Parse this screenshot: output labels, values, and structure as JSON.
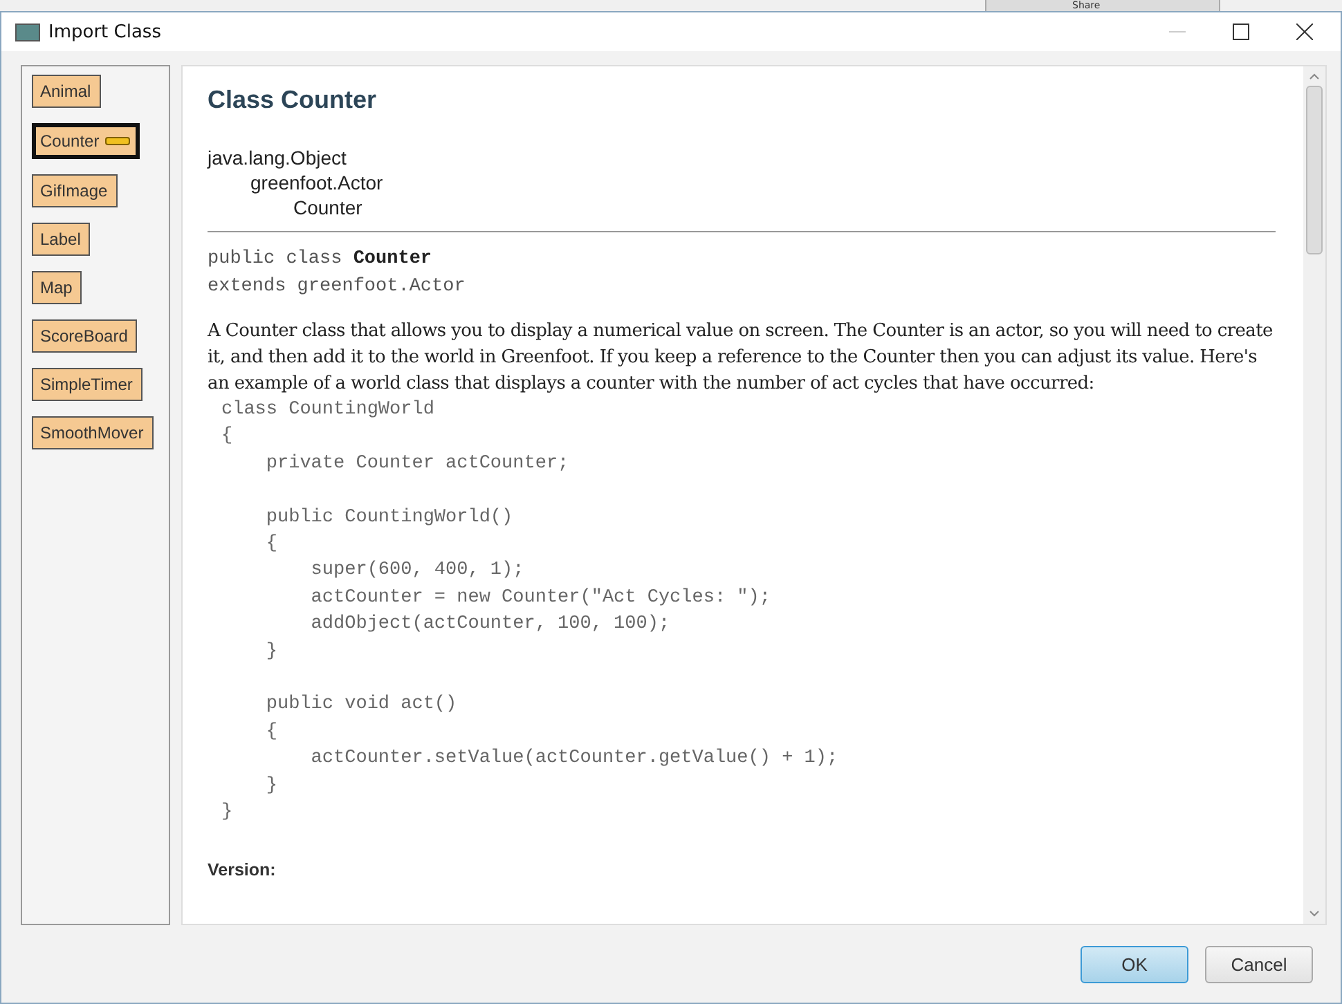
{
  "background": {
    "button": "Share"
  },
  "window": {
    "title": "Import Class"
  },
  "sidebar": {
    "items": [
      {
        "label": "Animal",
        "selected": false
      },
      {
        "label": "Counter",
        "selected": true
      },
      {
        "label": "GifImage",
        "selected": false
      },
      {
        "label": "Label",
        "selected": false
      },
      {
        "label": "Map",
        "selected": false
      },
      {
        "label": "ScoreBoard",
        "selected": false
      },
      {
        "label": "SimpleTimer",
        "selected": false
      },
      {
        "label": "SmoothMover",
        "selected": false
      }
    ]
  },
  "doc": {
    "title": "Class Counter",
    "hierarchy": [
      "java.lang.Object",
      "greenfoot.Actor",
      "Counter"
    ],
    "signature": {
      "prefix": "public class ",
      "name": "Counter",
      "extends": "extends greenfoot.Actor"
    },
    "description": "A Counter class that allows you to display a numerical value on screen. The Counter is an actor, so you will need to create it, and then add it to the world in Greenfoot. If you keep a reference to the Counter then you can adjust its value. Here's an example of a world class that displays a counter with the number of act cycles that have occurred:",
    "code": "class CountingWorld\n{\n    private Counter actCounter;\n\n    public CountingWorld()\n    {\n        super(600, 400, 1);\n        actCounter = new Counter(\"Act Cycles: \");\n        addObject(actCounter, 100, 100);\n    }\n\n    public void act()\n    {\n        actCounter.setValue(actCounter.getValue() + 1);\n    }\n}",
    "version_label": "Version:"
  },
  "buttons": [
    {
      "label": "OK",
      "default": true
    },
    {
      "label": "Cancel",
      "default": false
    }
  ]
}
